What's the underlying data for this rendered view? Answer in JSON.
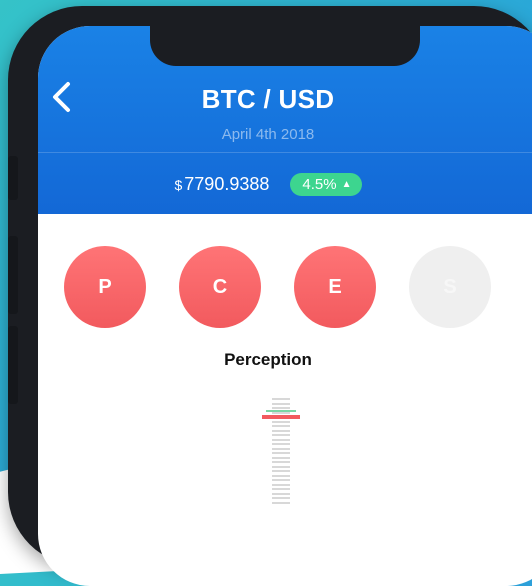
{
  "header": {
    "back_icon": "chevron-left-icon",
    "pair_title": "BTC / USD",
    "date": "April 4th 2018",
    "price_currency": "$",
    "price_value": "7790.9388",
    "change_badge": "4.5%",
    "change_direction": "up",
    "header_color": "#1570dc",
    "badge_color": "#3dd58f"
  },
  "metrics": {
    "items": [
      {
        "letter": "P",
        "state": "active"
      },
      {
        "letter": "C",
        "state": "active"
      },
      {
        "letter": "E",
        "state": "active"
      },
      {
        "letter": "S",
        "state": "inactive"
      }
    ],
    "active_color": "#f25a5e",
    "selected_label": "Perception"
  }
}
